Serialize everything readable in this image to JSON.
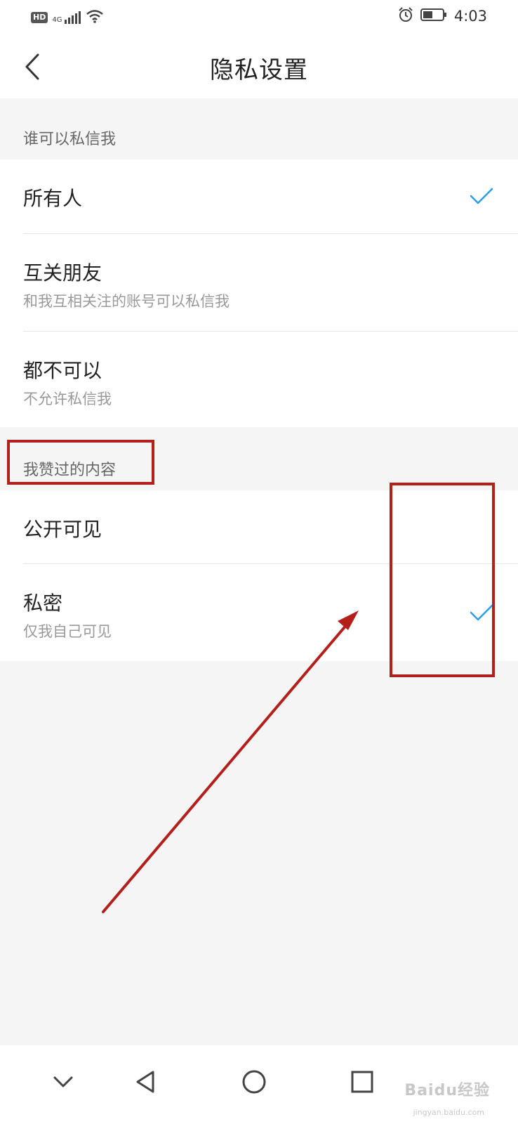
{
  "status_bar": {
    "hd": "HD",
    "network": "4G",
    "time": "4:03"
  },
  "header": {
    "title": "隐私设置",
    "back_icon": "chevron-left-icon"
  },
  "sections": [
    {
      "label": "谁可以私信我",
      "options": [
        {
          "title": "所有人",
          "subtitle": "",
          "selected": true
        },
        {
          "title": "互关朋友",
          "subtitle": "和我互相关注的账号可以私信我",
          "selected": false
        },
        {
          "title": "都不可以",
          "subtitle": "不允许私信我",
          "selected": false
        }
      ]
    },
    {
      "label": "我赞过的内容",
      "options": [
        {
          "title": "公开可见",
          "subtitle": "",
          "selected": false
        },
        {
          "title": "私密",
          "subtitle": "仅我自己可见",
          "selected": true
        }
      ]
    }
  ],
  "nav_bar": {
    "icons": [
      "collapse-icon",
      "back-triangle-icon",
      "home-circle-icon",
      "recents-square-icon"
    ]
  },
  "watermark": {
    "text": "Baidu经验",
    "sub": "jingyan.baidu.com"
  },
  "colors": {
    "check": "#2b9de8",
    "annotation": "#b3201c",
    "background": "#f5f5f5"
  }
}
